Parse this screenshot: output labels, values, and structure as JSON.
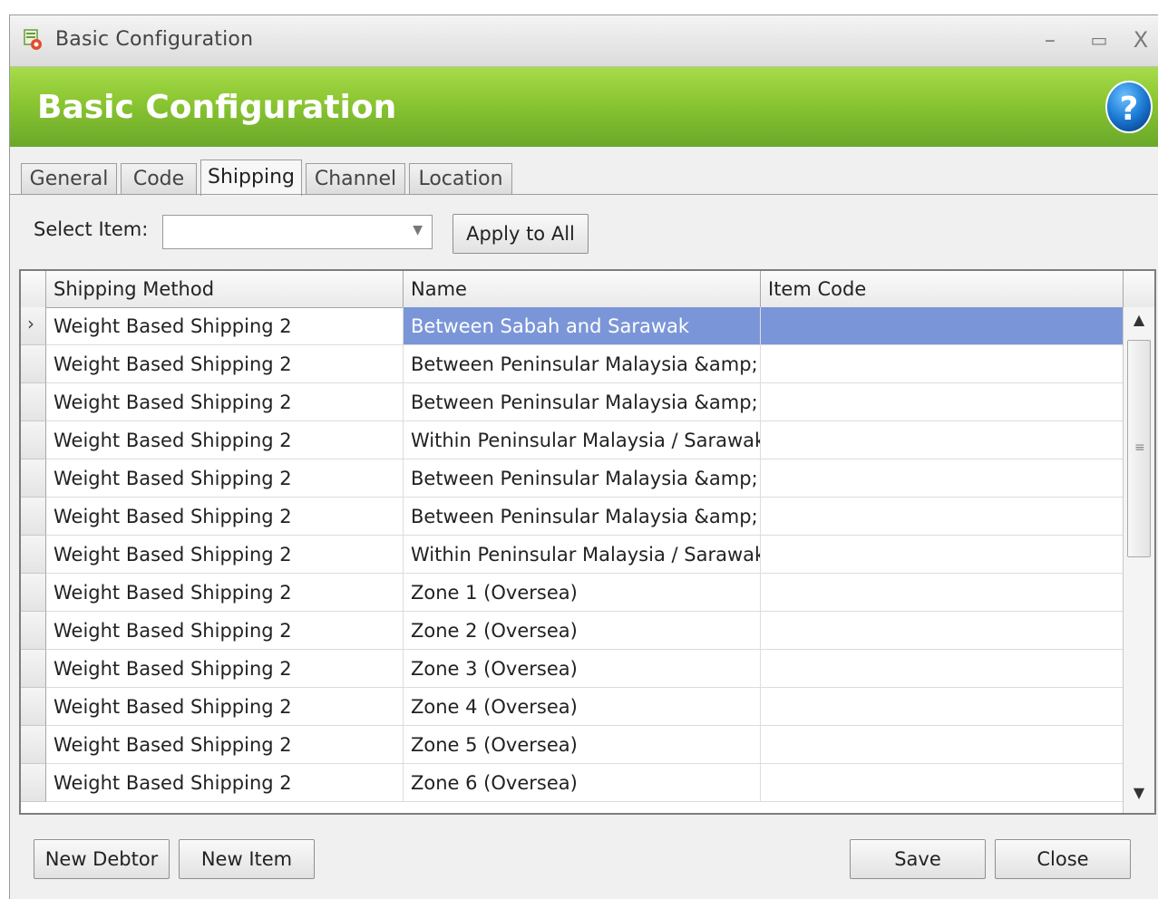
{
  "window": {
    "title": "Basic Configuration",
    "minimize": "–",
    "maximize": "▭",
    "close": "X"
  },
  "banner": {
    "title": "Basic Configuration",
    "help": "?"
  },
  "tabs": [
    {
      "label": "General"
    },
    {
      "label": "Code"
    },
    {
      "label": "Shipping"
    },
    {
      "label": "Channel"
    },
    {
      "label": "Location"
    }
  ],
  "active_tab": "Shipping",
  "select_item": {
    "label": "Select Item:",
    "value": ""
  },
  "apply_button": "Apply to All",
  "grid": {
    "columns": [
      "Shipping Method",
      "Name",
      "Item Code"
    ],
    "rows": [
      {
        "method": "Weight Based Shipping 2",
        "name": "Between Sabah and Sarawak",
        "code": ""
      },
      {
        "method": "Weight Based Shipping 2",
        "name": "Between Peninsular Malaysia &amp; ...",
        "code": ""
      },
      {
        "method": "Weight Based Shipping 2",
        "name": "Between Peninsular Malaysia &amp; ...",
        "code": ""
      },
      {
        "method": "Weight Based Shipping 2",
        "name": "Within Peninsular Malaysia / Sarawak...",
        "code": ""
      },
      {
        "method": "Weight Based Shipping 2",
        "name": "Between Peninsular Malaysia &amp; ...",
        "code": ""
      },
      {
        "method": "Weight Based Shipping 2",
        "name": "Between Peninsular Malaysia &amp; ...",
        "code": ""
      },
      {
        "method": "Weight Based Shipping 2",
        "name": "Within Peninsular Malaysia / Sarawak...",
        "code": ""
      },
      {
        "method": "Weight Based Shipping 2",
        "name": "Zone 1 (Oversea)",
        "code": ""
      },
      {
        "method": "Weight Based Shipping 2",
        "name": "Zone 2 (Oversea)",
        "code": ""
      },
      {
        "method": "Weight Based Shipping 2",
        "name": "Zone 3 (Oversea)",
        "code": ""
      },
      {
        "method": "Weight Based Shipping 2",
        "name": "Zone 4 (Oversea)",
        "code": ""
      },
      {
        "method": "Weight Based Shipping 2",
        "name": "Zone 5 (Oversea)",
        "code": ""
      },
      {
        "method": "Weight Based Shipping 2",
        "name": "Zone 6 (Oversea)",
        "code": ""
      }
    ],
    "current_row_marker": "›"
  },
  "footer": {
    "new_debtor": "New Debtor",
    "new_item": "New Item",
    "save": "Save",
    "close": "Close"
  },
  "colors": {
    "banner_green": "#8ac531",
    "selection_blue": "#7b96d8",
    "help_blue": "#1e7fd8"
  }
}
